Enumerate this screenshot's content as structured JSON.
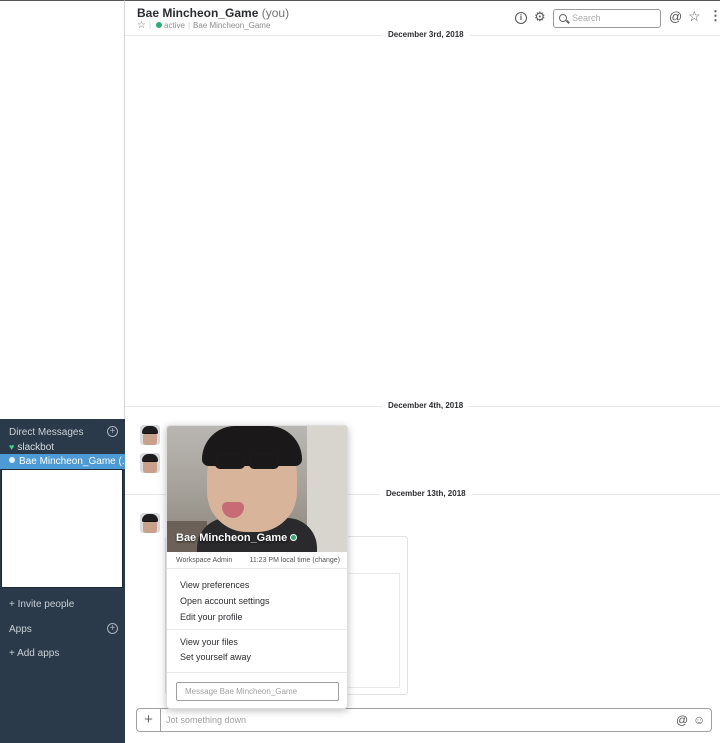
{
  "header": {
    "channel_name": "Bae Mincheon_Game",
    "you_suffix": "(you)",
    "status": "active",
    "display_name": "Bae Mincheon_Game",
    "search_placeholder": "Search"
  },
  "sidebar": {
    "direct_messages_label": "Direct Messages",
    "dm_items": [
      {
        "label": "slackbot",
        "icon": "heart-icon"
      },
      {
        "label": "Bae Mincheon_Game (...",
        "icon": "presence-dot-icon"
      }
    ],
    "invite_people": "+ Invite people",
    "apps_label": "Apps",
    "add_apps": "+ Add apps"
  },
  "messages": {
    "dates": [
      "December 3rd, 2018",
      "December 4th, 2018",
      "December 13th, 2018"
    ]
  },
  "composer": {
    "placeholder": "Jot something down"
  },
  "profile_popover": {
    "name": "Bae Mincheon_Game",
    "role": "Workspace Admin",
    "local_time": "11:23 PM local time (change)",
    "menu_group_1": [
      "View preferences",
      "Open account settings",
      "Edit your profile"
    ],
    "menu_group_2": [
      "View your files",
      "Set yourself away"
    ],
    "message_placeholder": "Message Bae Mincheon_Game"
  },
  "colors": {
    "sidebar_bg": "#2b3a4a",
    "active_item": "#4c9bd6",
    "presence_green": "#2bac76"
  }
}
